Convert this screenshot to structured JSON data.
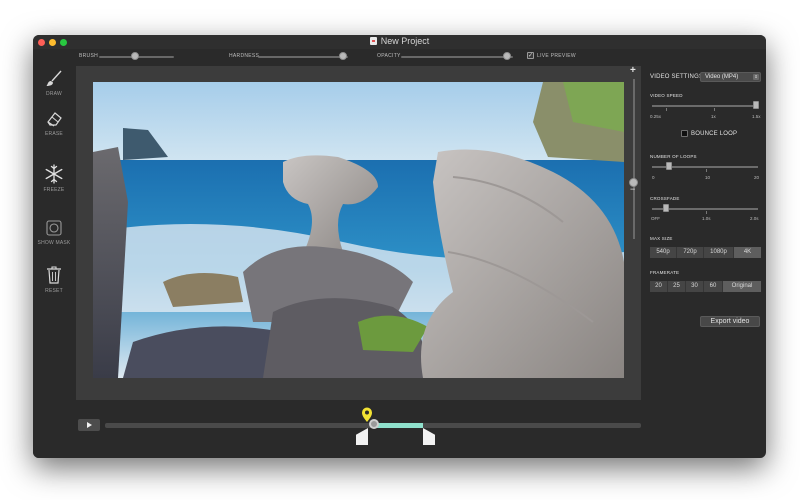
{
  "window": {
    "title": "New Project"
  },
  "toolbar": {
    "brush_label": "BRUSH",
    "brush_value": 0.5,
    "hardness_label": "HARDNESS",
    "hardness_value": 0.9,
    "opacity_label": "OPACITY",
    "opacity_value": 0.95,
    "live_preview_label": "LIVE PREVIEW",
    "live_preview_checked": true
  },
  "tools": [
    {
      "id": "draw",
      "label": "DRAW",
      "icon": "brush-icon"
    },
    {
      "id": "erase",
      "label": "ERASE",
      "icon": "eraser-icon"
    },
    {
      "id": "freeze",
      "label": "FREEZE",
      "icon": "snowflake-icon"
    },
    {
      "id": "showmask",
      "label": "SHOW MASK",
      "icon": "mask-icon"
    },
    {
      "id": "reset",
      "label": "RESET",
      "icon": "trash-icon"
    }
  ],
  "zoom": {
    "plus_icon": "plus-icon",
    "minus_icon": "minus-icon"
  },
  "settings": {
    "heading": "VIDEO SETTINGS",
    "format_value": "Video (MP4)",
    "video_speed": {
      "label": "VIDEO SPEED",
      "min": "0.25x",
      "mid": "1x",
      "max": "1.5x",
      "value": 1.5
    },
    "bounce_loop": {
      "label": "BOUNCE LOOP",
      "checked": false
    },
    "loops": {
      "label": "NUMBER OF LOOPS",
      "min": "0",
      "mid": "10",
      "max": "20",
      "value": 1
    },
    "crossfade": {
      "label": "CROSSFADE",
      "min": "OFF",
      "mid": "1.0s",
      "max": "2.0s",
      "value": 0
    },
    "max_size": {
      "label": "MAX SIZE",
      "options": [
        "540p",
        "720p",
        "1080p",
        "4K"
      ],
      "selected": "4K"
    },
    "framerate": {
      "label": "FRAMERATE",
      "options": [
        "20",
        "25",
        "30",
        "60",
        "Original"
      ],
      "selected": "Original"
    },
    "export_label": "Export video"
  },
  "colors": {
    "window_bg": "#2a2a2a",
    "accent_timeline": "#8fe0cc",
    "pin": "#f2e233"
  },
  "timeline": {
    "playhead_fraction": 0.5,
    "range_start": 0.5,
    "range_end": 0.59
  }
}
